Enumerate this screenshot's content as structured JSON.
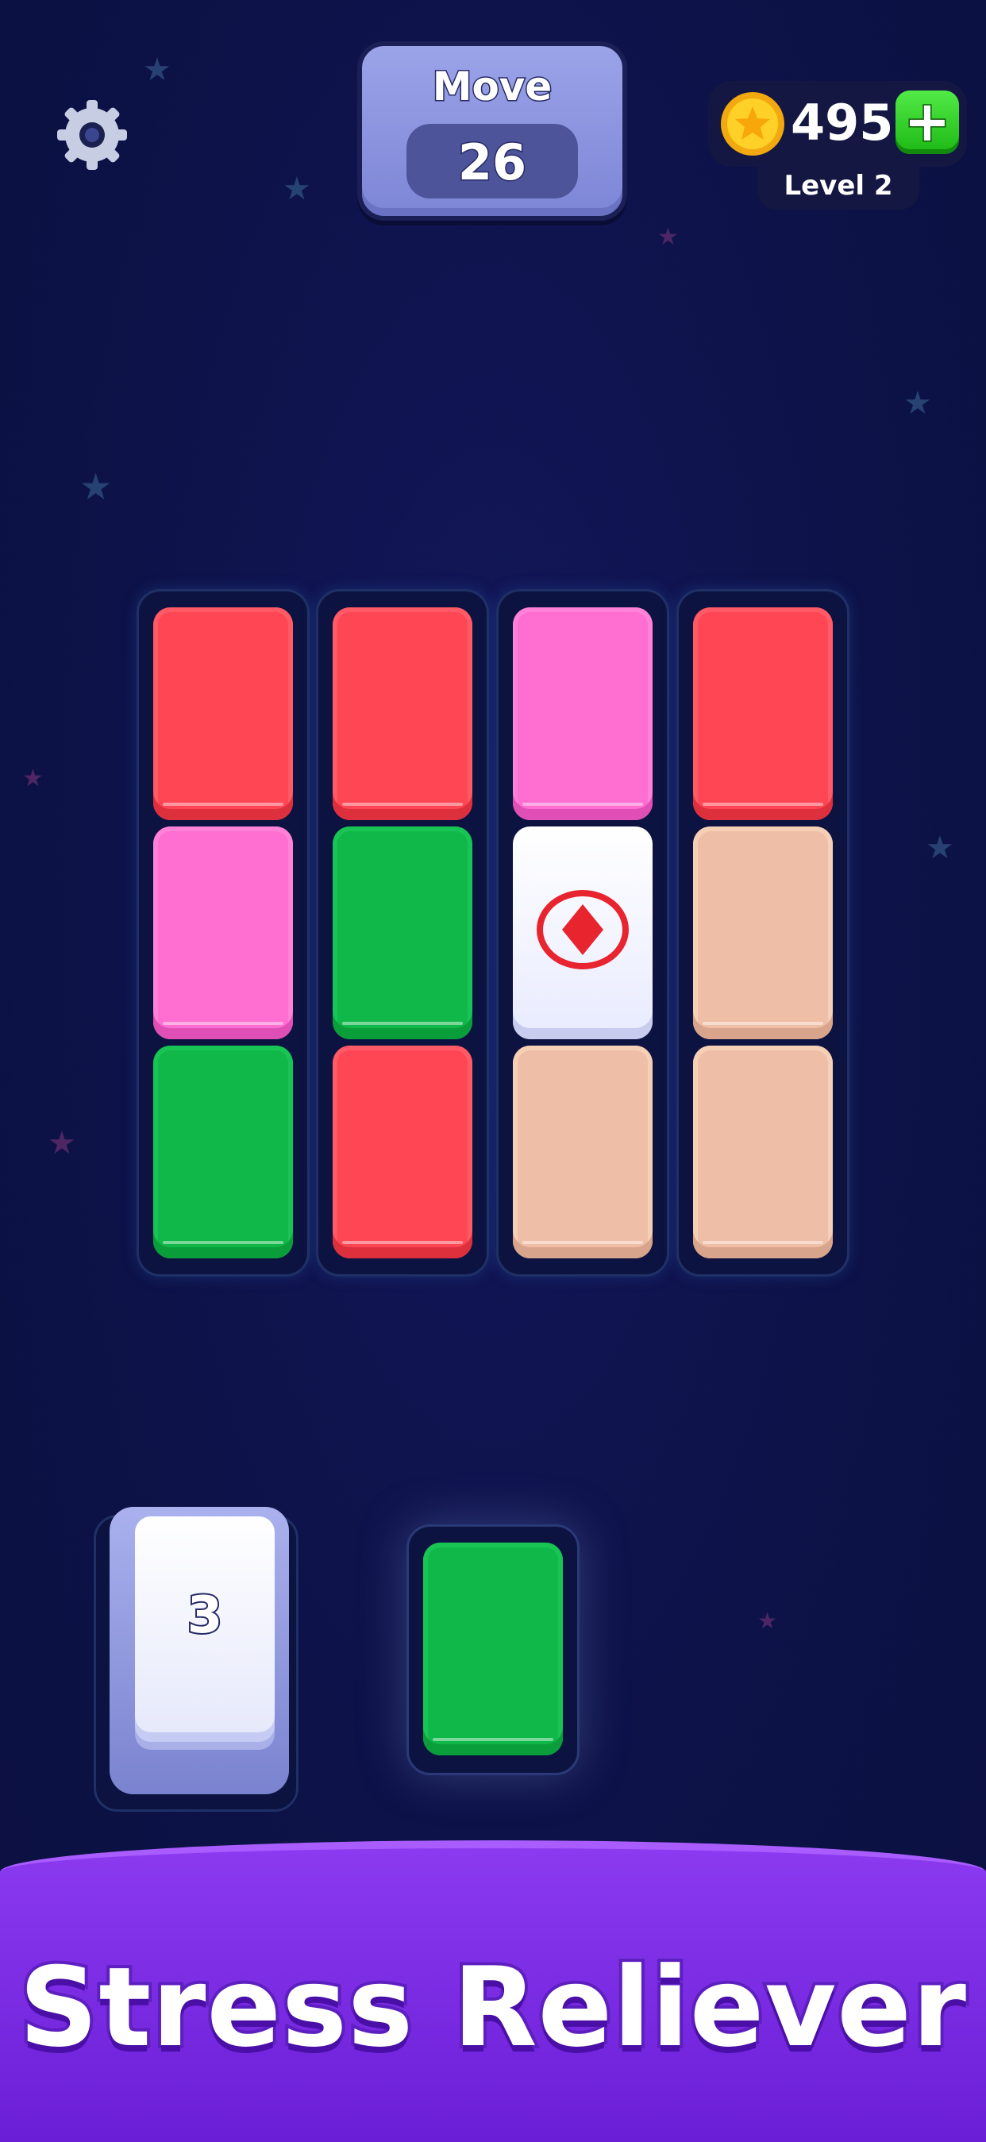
{
  "header": {
    "move_label": "Move",
    "move_count": "26",
    "coins": "495",
    "plus_glyph": "+",
    "level_label": "Level 2"
  },
  "icons": {
    "settings": "gear-icon",
    "coin": "coin-star-icon",
    "add": "plus-icon",
    "special_tile": "diamond-icon"
  },
  "board": {
    "columns": [
      [
        "red",
        "pink",
        "green"
      ],
      [
        "red",
        "green",
        "red"
      ],
      [
        "pink",
        "white-diamond",
        "peach"
      ],
      [
        "red",
        "peach",
        "peach"
      ]
    ]
  },
  "tray": {
    "stack_count": "3",
    "active_tile_color": "green"
  },
  "banner": {
    "title": "Stress Reliever"
  },
  "colors": {
    "red": "#ff4654",
    "pink": "#ff6ed0",
    "green": "#10b84a",
    "peach": "#efbea6",
    "banner": "#7b2ee6"
  }
}
